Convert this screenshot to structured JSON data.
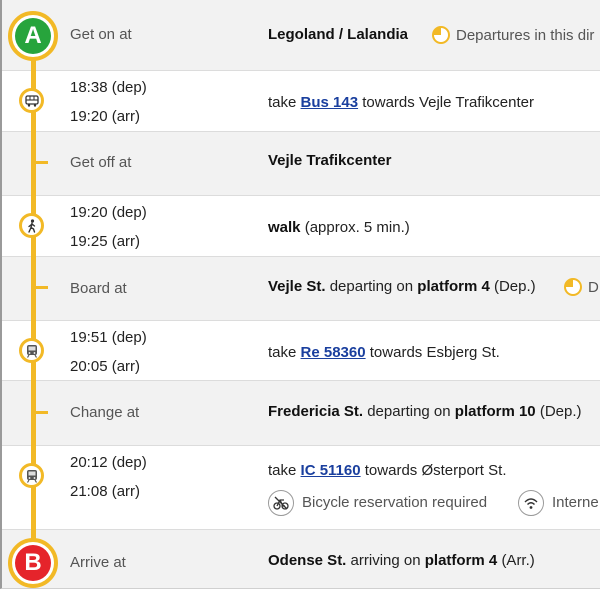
{
  "colors": {
    "accent": "#f2b926",
    "start": "#27a43c",
    "end": "#e5242b",
    "link": "#1a3f9e"
  },
  "start_marker": "A",
  "end_marker": "B",
  "rows": {
    "get_on": {
      "label": "Get on at",
      "station": "Legoland / Lalandia",
      "note": "Departures in this dir"
    },
    "bus_leg": {
      "dep": "18:38 (dep)",
      "arr": "19:20 (arr)",
      "take": "take",
      "line": "Bus 143",
      "towards": "towards Vejle Trafikcenter",
      "icon": "bus-icon"
    },
    "get_off": {
      "label": "Get off at",
      "station": "Vejle Trafikcenter"
    },
    "walk_leg": {
      "dep": "19:20 (dep)",
      "arr": "19:25 (arr)",
      "mode": "walk",
      "duration": "(approx. 5 min.)",
      "icon": "walking-person-icon"
    },
    "board": {
      "label": "Board at",
      "station": "Vejle St.",
      "departing": "departing on",
      "platform": "platform 4",
      "suffix": "(Dep.)",
      "note": "D"
    },
    "re_leg": {
      "dep": "19:51 (dep)",
      "arr": "20:05 (arr)",
      "take": "take",
      "line": "Re 58360",
      "towards": "towards Esbjerg St.",
      "icon": "train-icon"
    },
    "change": {
      "label": "Change at",
      "station": "Fredericia St.",
      "departing": "departing on",
      "platform": "platform 10",
      "suffix": "(Dep.)"
    },
    "ic_leg": {
      "dep": "20:12 (dep)",
      "arr": "21:08 (arr)",
      "take": "take",
      "line": "IC 51160",
      "towards": "towards Østerport St.",
      "icon": "train-icon",
      "feature1": "Bicycle reservation required",
      "feature2": "Interne"
    },
    "arrive": {
      "label": "Arrive at",
      "station": "Odense St.",
      "arriving": "arriving on",
      "platform": "platform 4",
      "suffix": "(Arr.)"
    }
  }
}
